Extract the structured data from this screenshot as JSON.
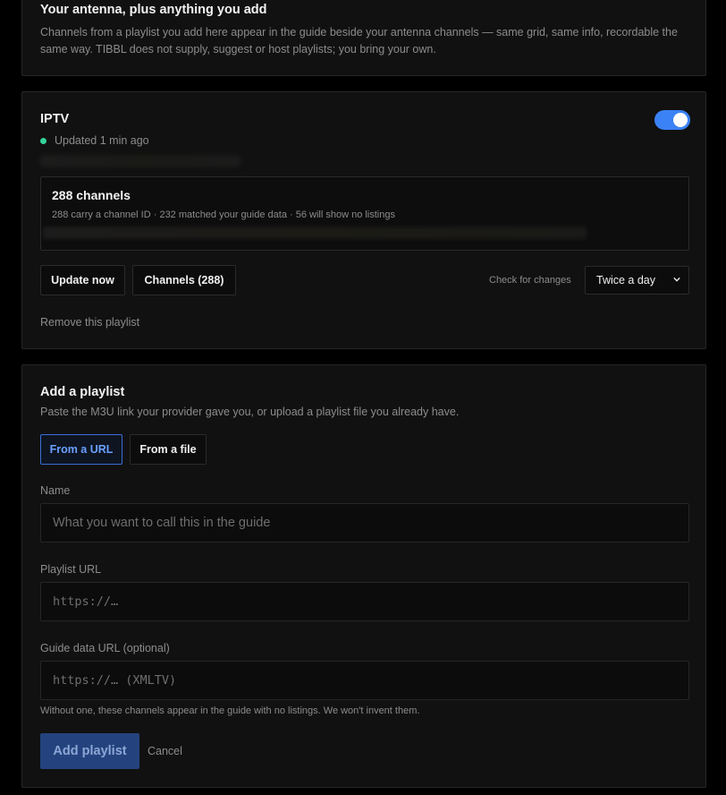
{
  "intro": {
    "title": "Your antenna, plus anything you add",
    "description": "Channels from a playlist you add here appear in the guide beside your antenna channels — same grid, same info, recordable the same way. TIBBL does not supply, suggest or host playlists; you bring your own."
  },
  "playlist": {
    "name": "IPTV",
    "enabled": true,
    "status": "Updated 1 min ago",
    "channels_title": "288 channels",
    "channels_detail": "288 carry a channel ID · 232 matched your guide data · 56 will show no listings",
    "update_button": "Update now",
    "channels_button": "Channels (288)",
    "check_label": "Check for changes",
    "check_value": "Twice a day",
    "remove_link": "Remove this playlist"
  },
  "add": {
    "title": "Add a playlist",
    "description": "Paste the M3U link your provider gave you, or upload a playlist file you already have.",
    "tabs": {
      "url": "From a URL",
      "file": "From a file"
    },
    "name_label": "Name",
    "name_placeholder": "What you want to call this in the guide",
    "url_label": "Playlist URL",
    "url_placeholder": "https://…",
    "guide_label": "Guide data URL (optional)",
    "guide_placeholder": "https://… (XMLTV)",
    "guide_hint": "Without one, these channels appear in the guide with no listings. We won't invent them.",
    "submit": "Add playlist",
    "cancel": "Cancel"
  },
  "colors": {
    "accent": "#3b82f6",
    "status_ok": "#34d399",
    "primary_button": "#24437e"
  },
  "icons": {
    "select_caret": "chevron-down-icon",
    "status": "status-dot"
  }
}
